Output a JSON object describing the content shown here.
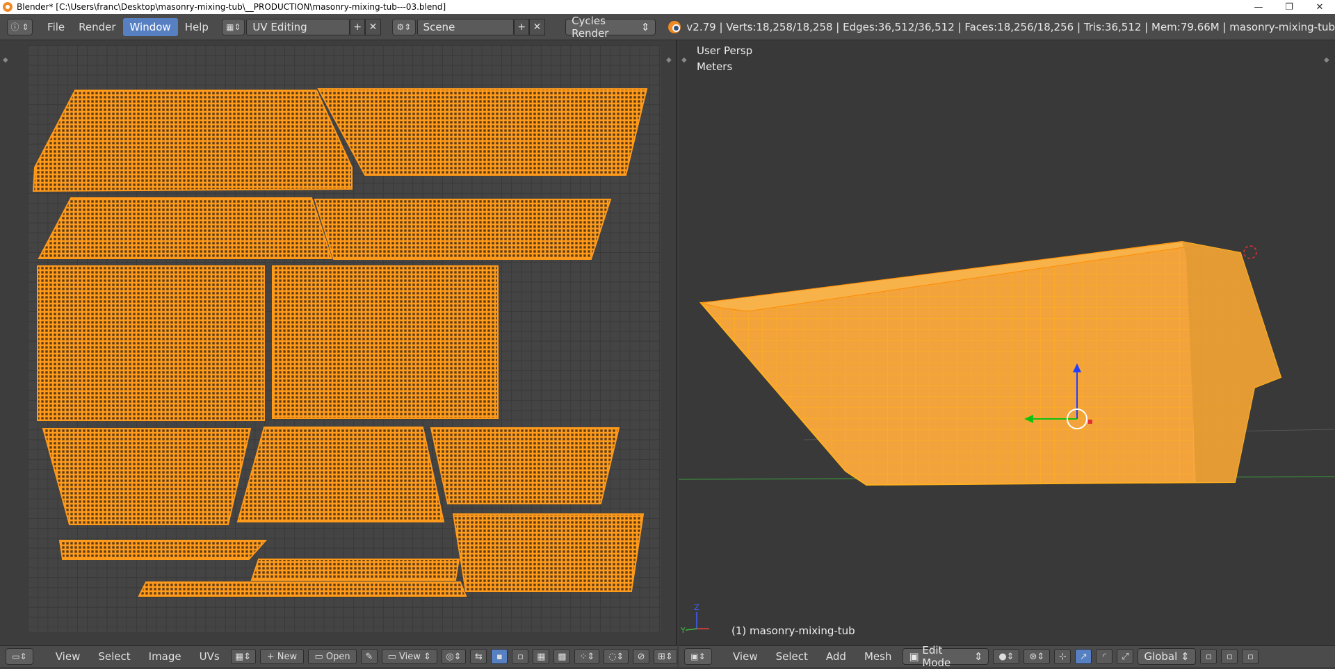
{
  "window": {
    "title": "Blender* [C:\\Users\\franc\\Desktop\\masonry-mixing-tub\\__PRODUCTION\\masonry-mixing-tub---03.blend]",
    "minimize": "—",
    "maximize": "❐",
    "close": "✕"
  },
  "infobar": {
    "menus": [
      "File",
      "Render",
      "Window",
      "Help"
    ],
    "active_menu": "Window",
    "layout": "UV Editing",
    "scene": "Scene",
    "engine": "Cycles Render",
    "stats": "v2.79 | Verts:18,258/18,258 | Edges:36,512/36,512 | Faces:18,256/18,256 | Tris:36,512 | Mem:79.66M | masonry-mixing-tub"
  },
  "viewport": {
    "view_name": "User Persp",
    "units": "Meters",
    "object_label": "(1) masonry-mixing-tub"
  },
  "uv_bottom": {
    "menus": [
      "View",
      "Select",
      "Image",
      "UVs"
    ],
    "new_label": "New",
    "open_label": "Open",
    "view_label": "View"
  },
  "vp_bottom": {
    "menus": [
      "View",
      "Select",
      "Add",
      "Mesh"
    ],
    "mode": "Edit Mode",
    "orientation": "Global"
  },
  "colors": {
    "accent": "#5680c2",
    "uv_islands": "#ff9a1a",
    "mesh": "#f7a830",
    "background": "#3d3d3d"
  }
}
